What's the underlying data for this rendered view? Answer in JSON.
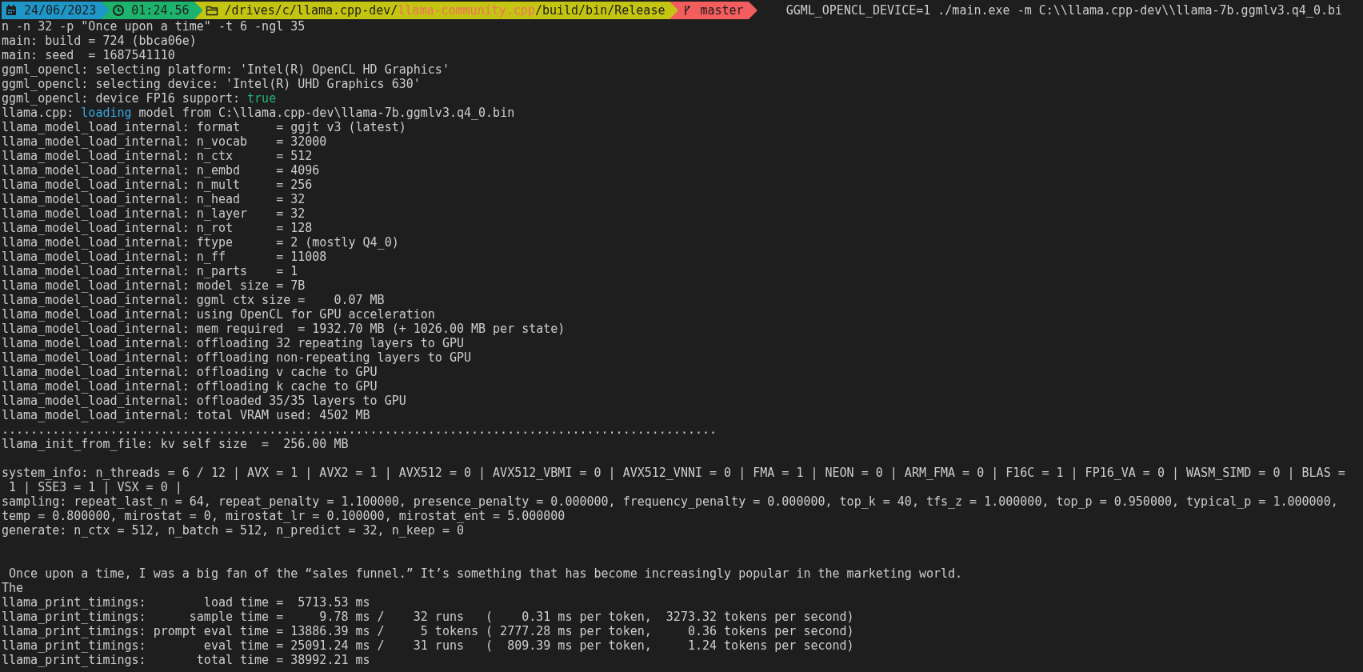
{
  "prompt": {
    "segments": [
      {
        "kind": "date",
        "parts": [
          {
            "text": "24/06/2023",
            "highlighted": false
          }
        ]
      },
      {
        "kind": "time",
        "parts": [
          {
            "text": "01:24.56",
            "highlighted": false
          }
        ]
      },
      {
        "kind": "path",
        "parts": [
          {
            "text": "/drives/c/llama.cpp-dev/",
            "highlighted": false
          },
          {
            "text": "llama-community.cpp",
            "highlighted": true
          },
          {
            "text": "/build/bin/Release",
            "highlighted": false
          }
        ]
      },
      {
        "kind": "branch",
        "parts": [
          {
            "text": "master",
            "highlighted": false
          }
        ]
      }
    ],
    "command": "GGML_OPENCL_DEVICE=1 ./main.exe -m C:\\\\llama.cpp-dev\\\\llama-7b.ggmlv3.q4_0.bi"
  },
  "lines": [
    {
      "spans": [
        {
          "text": "n -n 32 -p \"Once upon a time\" -t 6 -ngl 35"
        }
      ]
    },
    {
      "spans": [
        {
          "text": "main: build = 724 (bbca06e)"
        }
      ]
    },
    {
      "spans": [
        {
          "text": "main: seed  = 1687541110"
        }
      ]
    },
    {
      "spans": [
        {
          "text": "ggml_opencl: selecting platform: 'Intel(R) OpenCL HD Graphics'"
        }
      ]
    },
    {
      "spans": [
        {
          "text": "ggml_opencl: selecting device: 'Intel(R) UHD Graphics 630'"
        }
      ]
    },
    {
      "spans": [
        {
          "text": "ggml_opencl: device FP16 support: "
        },
        {
          "text": "true",
          "color": "#23b478"
        }
      ]
    },
    {
      "spans": [
        {
          "text": "llama.cpp: "
        },
        {
          "text": "loading",
          "color": "#3ba6e0"
        },
        {
          "text": " model from C:\\llama.cpp-dev\\llama-7b.ggmlv3.q4_0.bin"
        }
      ]
    },
    {
      "spans": [
        {
          "text": "llama_model_load_internal: format     = ggjt v3 (latest)"
        }
      ]
    },
    {
      "spans": [
        {
          "text": "llama_model_load_internal: n_vocab    = 32000"
        }
      ]
    },
    {
      "spans": [
        {
          "text": "llama_model_load_internal: n_ctx      = 512"
        }
      ]
    },
    {
      "spans": [
        {
          "text": "llama_model_load_internal: n_embd     = 4096"
        }
      ]
    },
    {
      "spans": [
        {
          "text": "llama_model_load_internal: n_mult     = 256"
        }
      ]
    },
    {
      "spans": [
        {
          "text": "llama_model_load_internal: n_head     = 32"
        }
      ]
    },
    {
      "spans": [
        {
          "text": "llama_model_load_internal: n_layer    = 32"
        }
      ]
    },
    {
      "spans": [
        {
          "text": "llama_model_load_internal: n_rot      = 128"
        }
      ]
    },
    {
      "spans": [
        {
          "text": "llama_model_load_internal: ftype      = 2 (mostly Q4_0)"
        }
      ]
    },
    {
      "spans": [
        {
          "text": "llama_model_load_internal: n_ff       = 11008"
        }
      ]
    },
    {
      "spans": [
        {
          "text": "llama_model_load_internal: n_parts    = 1"
        }
      ]
    },
    {
      "spans": [
        {
          "text": "llama_model_load_internal: model size = 7B"
        }
      ]
    },
    {
      "spans": [
        {
          "text": "llama_model_load_internal: ggml ctx size =    0.07 MB"
        }
      ]
    },
    {
      "spans": [
        {
          "text": "llama_model_load_internal: using OpenCL for GPU acceleration"
        }
      ]
    },
    {
      "spans": [
        {
          "text": "llama_model_load_internal: mem required  = 1932.70 MB (+ 1026.00 MB per state)"
        }
      ]
    },
    {
      "spans": [
        {
          "text": "llama_model_load_internal: offloading 32 repeating layers to GPU"
        }
      ]
    },
    {
      "spans": [
        {
          "text": "llama_model_load_internal: offloading non-repeating layers to GPU"
        }
      ]
    },
    {
      "spans": [
        {
          "text": "llama_model_load_internal: offloading v cache to GPU"
        }
      ]
    },
    {
      "spans": [
        {
          "text": "llama_model_load_internal: offloading k cache to GPU"
        }
      ]
    },
    {
      "spans": [
        {
          "text": "llama_model_load_internal: offloaded 35/35 layers to GPU"
        }
      ]
    },
    {
      "spans": [
        {
          "text": "llama_model_load_internal: total VRAM used: 4502 MB"
        }
      ]
    },
    {
      "spans": [
        {
          "text": "..................................................................................................."
        }
      ]
    },
    {
      "spans": [
        {
          "text": "llama_init_from_file: kv self size  =  256.00 MB"
        }
      ]
    },
    {
      "kind": "blank"
    },
    {
      "spans": [
        {
          "text": "system_info: n_threads = 6 / 12 | AVX = 1 | AVX2 = 1 | AVX512 = 0 | AVX512_VBMI = 0 | AVX512_VNNI = 0 | FMA = 1 | NEON = 0 | ARM_FMA = 0 | F16C = 1 | FP16_VA = 0 | WASM_SIMD = 0 | BLAS ="
        }
      ]
    },
    {
      "spans": [
        {
          "text": " 1 | SSE3 = 1 | VSX = 0 |"
        }
      ]
    },
    {
      "spans": [
        {
          "text": "sampling: repeat_last_n = 64, repeat_penalty = 1.100000, presence_penalty = 0.000000, frequency_penalty = 0.000000, top_k = 40, tfs_z = 1.000000, top_p = 0.950000, typical_p = 1.000000,"
        }
      ]
    },
    {
      "spans": [
        {
          "text": "temp = 0.800000, mirostat = 0, mirostat_lr = 0.100000, mirostat_ent = 5.000000"
        }
      ]
    },
    {
      "spans": [
        {
          "text": "generate: n_ctx = 512, n_batch = 512, n_predict = 32, n_keep = 0"
        }
      ]
    },
    {
      "kind": "blank"
    },
    {
      "kind": "blank"
    },
    {
      "spans": [
        {
          "text": " Once upon a time, I was a big fan of the “sales funnel.” It’s something that has become increasingly popular in the marketing world."
        }
      ]
    },
    {
      "spans": [
        {
          "text": "The"
        }
      ]
    },
    {
      "spans": [
        {
          "text": "llama_print_timings:        load time =  5713.53 ms"
        }
      ]
    },
    {
      "spans": [
        {
          "text": "llama_print_timings:      sample time =     9.78 ms /    32 runs   (    0.31 ms per token,  3273.32 tokens per second)"
        }
      ]
    },
    {
      "spans": [
        {
          "text": "llama_print_timings: prompt eval time = 13886.39 ms /     5 tokens ( 2777.28 ms per token,     0.36 tokens per second)"
        }
      ]
    },
    {
      "spans": [
        {
          "text": "llama_print_timings:        eval time = 25091.24 ms /    31 runs   (  809.39 ms per token,     1.24 tokens per second)"
        }
      ]
    },
    {
      "spans": [
        {
          "text": "llama_print_timings:       total time = 38992.21 ms"
        }
      ]
    }
  ]
}
